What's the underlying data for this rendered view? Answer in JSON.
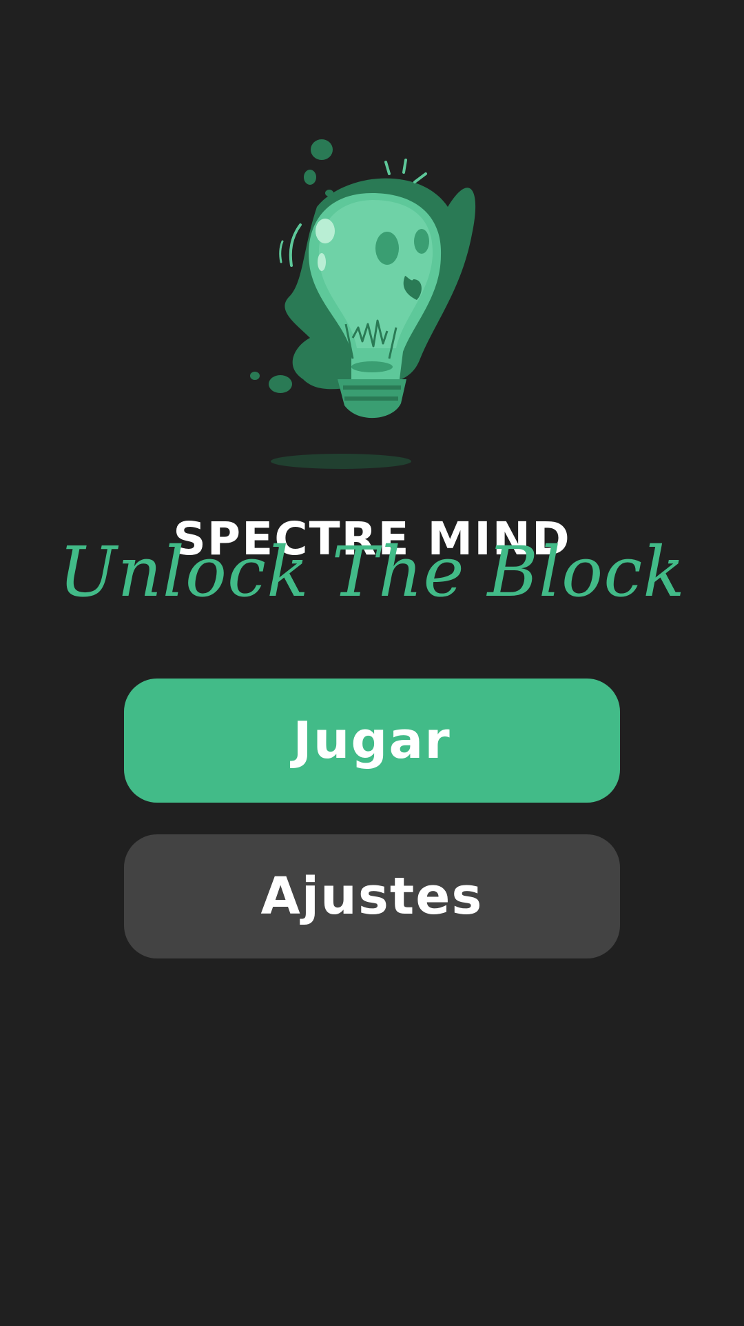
{
  "app": {
    "title": "SPECTRE MIND",
    "tagline": "Unlock The Block"
  },
  "menu": {
    "play_label": "Jugar",
    "settings_label": "Ajustes"
  },
  "colors": {
    "background": "#202020",
    "accent": "#42bb88",
    "accent_dark": "#2a7a55",
    "secondary_button": "#434343",
    "text": "#ffffff"
  },
  "icons": {
    "logo": "lightbulb-icon"
  }
}
